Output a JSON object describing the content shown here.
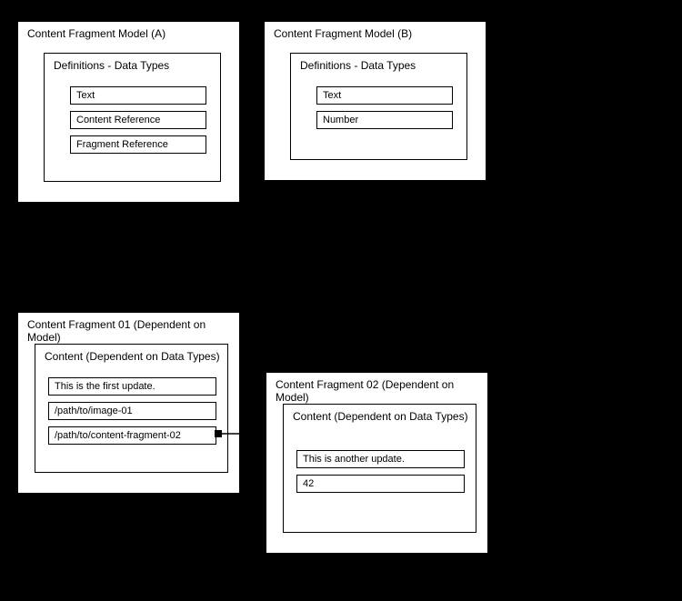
{
  "modelA": {
    "title": "Content Fragment Model (A)",
    "definitions": {
      "title": "Definitions - Data Types",
      "fields": [
        "Text",
        "Content Reference",
        "Fragment Reference"
      ]
    }
  },
  "modelB": {
    "title": "Content Fragment Model (B)",
    "definitions": {
      "title": "Definitions - Data Types",
      "fields": [
        "Text",
        "Number"
      ]
    }
  },
  "fragment1": {
    "title": "Content Fragment  01 (Dependent on Model)",
    "content": {
      "title": "Content (Dependent on Data Types)",
      "fields": [
        "This is the first update.",
        "/path/to/image-01",
        "/path/to/content-fragment-02"
      ]
    }
  },
  "fragment2": {
    "title": "Content Fragment 02 (Dependent on Model)",
    "content": {
      "title": "Content  (Dependent on Data Types)",
      "fields": [
        "This is another update.",
        "42"
      ]
    }
  }
}
